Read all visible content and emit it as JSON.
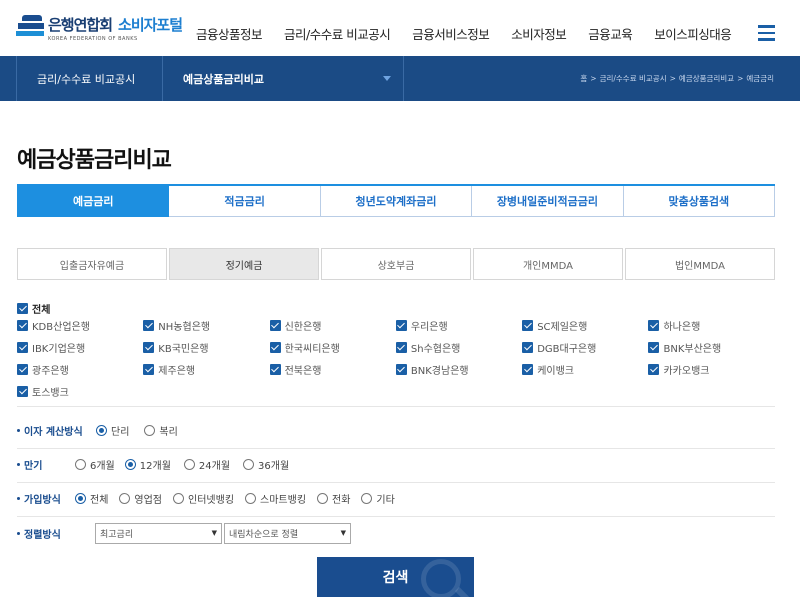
{
  "header": {
    "org_name": "은행연합회",
    "portal_name": "소비자포털",
    "org_english": "KOREA FEDERATION OF BANKS",
    "menu": [
      "금융상품정보",
      "금리/수수료 비교공시",
      "금융서비스정보",
      "소비자정보",
      "금융교육",
      "보이스피싱대응"
    ],
    "menu_icon": "hamburger-icon"
  },
  "subnav": {
    "section": "금리/수수료 비교공시",
    "current": "예금상품금리비교",
    "breadcrumb": [
      "홈",
      "금리/수수료 비교공시",
      "예금상품금리비교",
      "예금금리"
    ]
  },
  "page": {
    "title": "예금상품금리비교"
  },
  "tabs": [
    "예금금리",
    "적금금리",
    "청년도약계좌금리",
    "장병내일준비적금금리",
    "맞춤상품검색"
  ],
  "subtabs": [
    "입출금자유예금",
    "정기예금",
    "상호부금",
    "개인MMDA",
    "법인MMDA"
  ],
  "banks": {
    "all_label": "전체",
    "list": [
      "KDB산업은행",
      "NH농협은행",
      "신한은행",
      "우리은행",
      "SC제일은행",
      "하나은행",
      "IBK기업은행",
      "KB국민은행",
      "한국씨티은행",
      "Sh수협은행",
      "DGB대구은행",
      "BNK부산은행",
      "광주은행",
      "제주은행",
      "전북은행",
      "BNK경남은행",
      "케이뱅크",
      "카카오뱅크",
      "토스뱅크"
    ]
  },
  "options": {
    "interest": {
      "label": "이자 계산방식",
      "choices": [
        "단리",
        "복리"
      ],
      "selected": "단리"
    },
    "term": {
      "label": "만기",
      "choices": [
        "6개월",
        "12개월",
        "24개월",
        "36개월"
      ],
      "selected": "12개월"
    },
    "join": {
      "label": "가입방식",
      "choices": [
        "전체",
        "영업점",
        "인터넷뱅킹",
        "스마트뱅킹",
        "전화",
        "기타"
      ],
      "selected": "전체"
    },
    "sort": {
      "label": "정렬방식",
      "field": "최고금리",
      "order": "내림차순으로 정렬"
    }
  },
  "search_button": "검색",
  "colors": {
    "navy": "#1b4b85",
    "accent": "#1d8fe0"
  }
}
